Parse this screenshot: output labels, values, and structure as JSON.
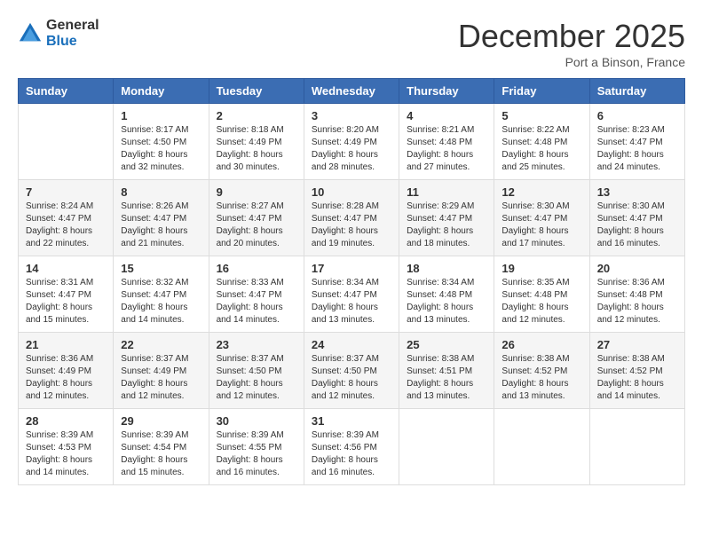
{
  "logo": {
    "general": "General",
    "blue": "Blue"
  },
  "title": "December 2025",
  "location": "Port a Binson, France",
  "days_of_week": [
    "Sunday",
    "Monday",
    "Tuesday",
    "Wednesday",
    "Thursday",
    "Friday",
    "Saturday"
  ],
  "weeks": [
    [
      {
        "day": "",
        "sunrise": "",
        "sunset": "",
        "daylight": ""
      },
      {
        "day": "1",
        "sunrise": "Sunrise: 8:17 AM",
        "sunset": "Sunset: 4:50 PM",
        "daylight": "Daylight: 8 hours and 32 minutes."
      },
      {
        "day": "2",
        "sunrise": "Sunrise: 8:18 AM",
        "sunset": "Sunset: 4:49 PM",
        "daylight": "Daylight: 8 hours and 30 minutes."
      },
      {
        "day": "3",
        "sunrise": "Sunrise: 8:20 AM",
        "sunset": "Sunset: 4:49 PM",
        "daylight": "Daylight: 8 hours and 28 minutes."
      },
      {
        "day": "4",
        "sunrise": "Sunrise: 8:21 AM",
        "sunset": "Sunset: 4:48 PM",
        "daylight": "Daylight: 8 hours and 27 minutes."
      },
      {
        "day": "5",
        "sunrise": "Sunrise: 8:22 AM",
        "sunset": "Sunset: 4:48 PM",
        "daylight": "Daylight: 8 hours and 25 minutes."
      },
      {
        "day": "6",
        "sunrise": "Sunrise: 8:23 AM",
        "sunset": "Sunset: 4:47 PM",
        "daylight": "Daylight: 8 hours and 24 minutes."
      }
    ],
    [
      {
        "day": "7",
        "sunrise": "Sunrise: 8:24 AM",
        "sunset": "Sunset: 4:47 PM",
        "daylight": "Daylight: 8 hours and 22 minutes."
      },
      {
        "day": "8",
        "sunrise": "Sunrise: 8:26 AM",
        "sunset": "Sunset: 4:47 PM",
        "daylight": "Daylight: 8 hours and 21 minutes."
      },
      {
        "day": "9",
        "sunrise": "Sunrise: 8:27 AM",
        "sunset": "Sunset: 4:47 PM",
        "daylight": "Daylight: 8 hours and 20 minutes."
      },
      {
        "day": "10",
        "sunrise": "Sunrise: 8:28 AM",
        "sunset": "Sunset: 4:47 PM",
        "daylight": "Daylight: 8 hours and 19 minutes."
      },
      {
        "day": "11",
        "sunrise": "Sunrise: 8:29 AM",
        "sunset": "Sunset: 4:47 PM",
        "daylight": "Daylight: 8 hours and 18 minutes."
      },
      {
        "day": "12",
        "sunrise": "Sunrise: 8:30 AM",
        "sunset": "Sunset: 4:47 PM",
        "daylight": "Daylight: 8 hours and 17 minutes."
      },
      {
        "day": "13",
        "sunrise": "Sunrise: 8:30 AM",
        "sunset": "Sunset: 4:47 PM",
        "daylight": "Daylight: 8 hours and 16 minutes."
      }
    ],
    [
      {
        "day": "14",
        "sunrise": "Sunrise: 8:31 AM",
        "sunset": "Sunset: 4:47 PM",
        "daylight": "Daylight: 8 hours and 15 minutes."
      },
      {
        "day": "15",
        "sunrise": "Sunrise: 8:32 AM",
        "sunset": "Sunset: 4:47 PM",
        "daylight": "Daylight: 8 hours and 14 minutes."
      },
      {
        "day": "16",
        "sunrise": "Sunrise: 8:33 AM",
        "sunset": "Sunset: 4:47 PM",
        "daylight": "Daylight: 8 hours and 14 minutes."
      },
      {
        "day": "17",
        "sunrise": "Sunrise: 8:34 AM",
        "sunset": "Sunset: 4:47 PM",
        "daylight": "Daylight: 8 hours and 13 minutes."
      },
      {
        "day": "18",
        "sunrise": "Sunrise: 8:34 AM",
        "sunset": "Sunset: 4:48 PM",
        "daylight": "Daylight: 8 hours and 13 minutes."
      },
      {
        "day": "19",
        "sunrise": "Sunrise: 8:35 AM",
        "sunset": "Sunset: 4:48 PM",
        "daylight": "Daylight: 8 hours and 12 minutes."
      },
      {
        "day": "20",
        "sunrise": "Sunrise: 8:36 AM",
        "sunset": "Sunset: 4:48 PM",
        "daylight": "Daylight: 8 hours and 12 minutes."
      }
    ],
    [
      {
        "day": "21",
        "sunrise": "Sunrise: 8:36 AM",
        "sunset": "Sunset: 4:49 PM",
        "daylight": "Daylight: 8 hours and 12 minutes."
      },
      {
        "day": "22",
        "sunrise": "Sunrise: 8:37 AM",
        "sunset": "Sunset: 4:49 PM",
        "daylight": "Daylight: 8 hours and 12 minutes."
      },
      {
        "day": "23",
        "sunrise": "Sunrise: 8:37 AM",
        "sunset": "Sunset: 4:50 PM",
        "daylight": "Daylight: 8 hours and 12 minutes."
      },
      {
        "day": "24",
        "sunrise": "Sunrise: 8:37 AM",
        "sunset": "Sunset: 4:50 PM",
        "daylight": "Daylight: 8 hours and 12 minutes."
      },
      {
        "day": "25",
        "sunrise": "Sunrise: 8:38 AM",
        "sunset": "Sunset: 4:51 PM",
        "daylight": "Daylight: 8 hours and 13 minutes."
      },
      {
        "day": "26",
        "sunrise": "Sunrise: 8:38 AM",
        "sunset": "Sunset: 4:52 PM",
        "daylight": "Daylight: 8 hours and 13 minutes."
      },
      {
        "day": "27",
        "sunrise": "Sunrise: 8:38 AM",
        "sunset": "Sunset: 4:52 PM",
        "daylight": "Daylight: 8 hours and 14 minutes."
      }
    ],
    [
      {
        "day": "28",
        "sunrise": "Sunrise: 8:39 AM",
        "sunset": "Sunset: 4:53 PM",
        "daylight": "Daylight: 8 hours and 14 minutes."
      },
      {
        "day": "29",
        "sunrise": "Sunrise: 8:39 AM",
        "sunset": "Sunset: 4:54 PM",
        "daylight": "Daylight: 8 hours and 15 minutes."
      },
      {
        "day": "30",
        "sunrise": "Sunrise: 8:39 AM",
        "sunset": "Sunset: 4:55 PM",
        "daylight": "Daylight: 8 hours and 16 minutes."
      },
      {
        "day": "31",
        "sunrise": "Sunrise: 8:39 AM",
        "sunset": "Sunset: 4:56 PM",
        "daylight": "Daylight: 8 hours and 16 minutes."
      },
      {
        "day": "",
        "sunrise": "",
        "sunset": "",
        "daylight": ""
      },
      {
        "day": "",
        "sunrise": "",
        "sunset": "",
        "daylight": ""
      },
      {
        "day": "",
        "sunrise": "",
        "sunset": "",
        "daylight": ""
      }
    ]
  ]
}
